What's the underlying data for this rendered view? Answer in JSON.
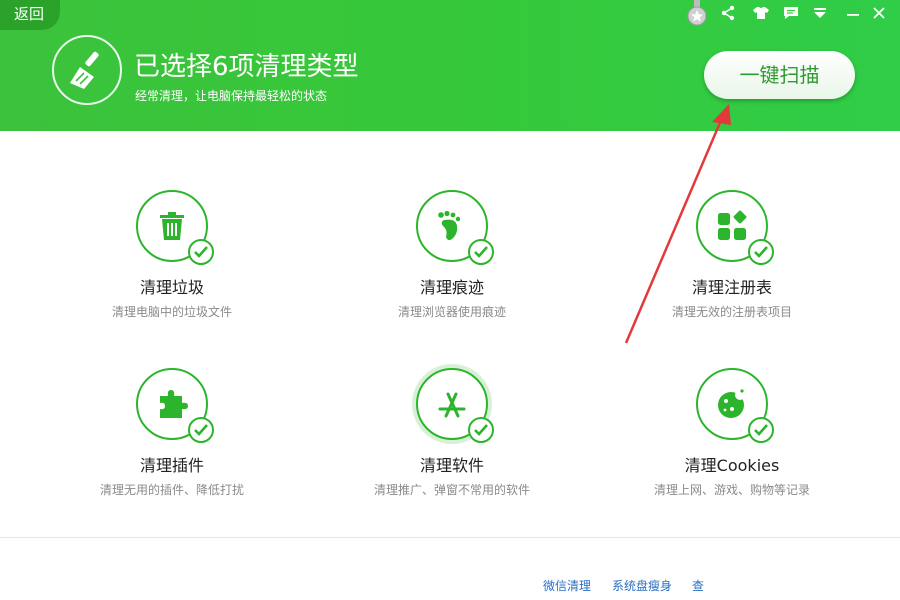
{
  "header": {
    "back_label": "返回",
    "title": "已选择6项清理类型",
    "subtitle": "经常清理，让电脑保持最轻松的状态",
    "scan_button": "一键扫描"
  },
  "top_icons": [
    "medal-icon",
    "share-icon",
    "skin-icon",
    "message-icon",
    "menu-icon",
    "minimize-icon",
    "close-icon"
  ],
  "items": [
    {
      "label": "清理垃圾",
      "desc": "清理电脑中的垃圾文件",
      "icon": "trash-icon",
      "checked": true
    },
    {
      "label": "清理痕迹",
      "desc": "清理浏览器使用痕迹",
      "icon": "footprint-icon",
      "checked": true
    },
    {
      "label": "清理注册表",
      "desc": "清理无效的注册表项目",
      "icon": "registry-icon",
      "checked": true
    },
    {
      "label": "清理插件",
      "desc": "清理无用的插件、降低打扰",
      "icon": "puzzle-icon",
      "checked": true
    },
    {
      "label": "清理软件",
      "desc": "清理推广、弹窗不常用的软件",
      "icon": "app-store-icon",
      "checked": true
    },
    {
      "label": "清理Cookies",
      "desc": "清理上网、游戏、购物等记录",
      "icon": "cookie-icon",
      "checked": true
    }
  ],
  "footer": {
    "links": [
      "微信清理",
      "系统盘瘦身",
      "查"
    ]
  },
  "colors": {
    "brand_green": "#36c83a",
    "icon_green": "#2cb52c",
    "link_blue": "#2a6fc4",
    "annotation_red": "#e23a3a"
  }
}
